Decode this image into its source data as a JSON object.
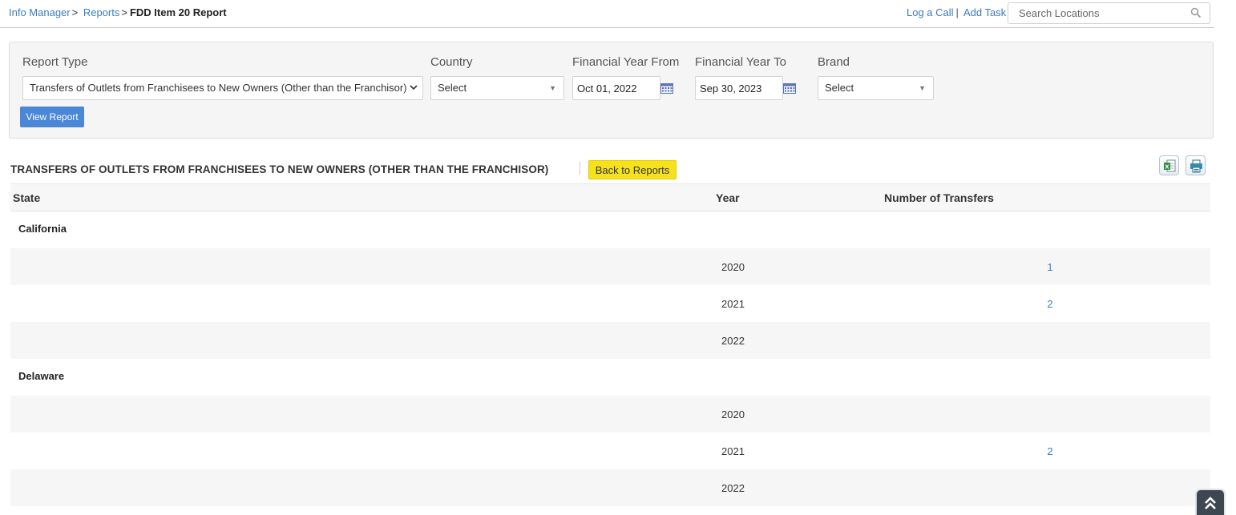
{
  "breadcrumb": {
    "items": [
      "Info Manager",
      "Reports"
    ],
    "separator": ">",
    "current": "FDD Item 20 Report"
  },
  "toplinks": {
    "log_call": "Log a Call",
    "separator": "|",
    "add_task": "Add Task"
  },
  "search": {
    "placeholder": "Search Locations"
  },
  "filters": {
    "report_type_label": "Report Type",
    "report_type_value": "Transfers of Outlets from Franchisees to New Owners (Other than the Franchisor)",
    "country_label": "Country",
    "country_value": "Select",
    "fy_from_label": "Financial Year From",
    "fy_from_value": "Oct 01, 2022",
    "fy_to_label": "Financial Year To",
    "fy_to_value": "Sep 30, 2023",
    "brand_label": "Brand",
    "brand_value": "Select",
    "view_button": "View Report"
  },
  "report": {
    "title": "TRANSFERS OF OUTLETS FROM FRANCHISEES TO NEW OWNERS (OTHER THAN THE FRANCHISOR)",
    "back_button": "Back to Reports",
    "icons": [
      "excel-export-icon",
      "print-icon"
    ],
    "columns": [
      "State",
      "Year",
      "Number of Transfers"
    ],
    "groups": [
      {
        "state": "California",
        "rows": [
          {
            "year": "2020",
            "transfers": "1"
          },
          {
            "year": "2021",
            "transfers": "2"
          },
          {
            "year": "2022",
            "transfers": ""
          }
        ]
      },
      {
        "state": "Delaware",
        "rows": [
          {
            "year": "2020",
            "transfers": ""
          },
          {
            "year": "2021",
            "transfers": "2"
          },
          {
            "year": "2022",
            "transfers": ""
          }
        ]
      }
    ]
  },
  "colors": {
    "link": "#3b7cc4",
    "primary_button": "#4a87d6",
    "back_button": "#f5e21c",
    "scroll_top_button": "#3c4752"
  }
}
